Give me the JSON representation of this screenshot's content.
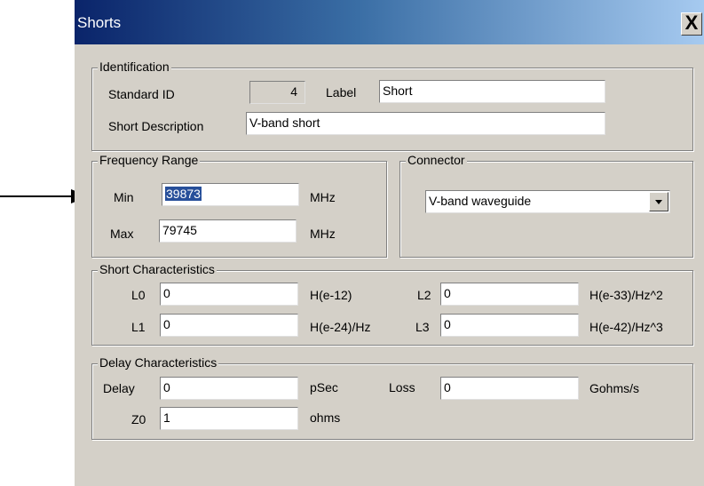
{
  "window": {
    "title": "Shorts",
    "close_glyph": "X"
  },
  "identification": {
    "legend": "Identification",
    "standard_id_label": "Standard ID",
    "standard_id_value": "4",
    "label_label": "Label",
    "label_value": "Short",
    "short_desc_label": "Short Description",
    "short_desc_value": "V-band short"
  },
  "frequency": {
    "legend": "Frequency Range",
    "min_label": "Min",
    "min_value": "39873",
    "min_unit": "MHz",
    "max_label": "Max",
    "max_value": "79745",
    "max_unit": "MHz"
  },
  "connector": {
    "legend": "Connector",
    "value": "V-band waveguide"
  },
  "short_char": {
    "legend": "Short Characteristics",
    "l0_label": "L0",
    "l0_value": "0",
    "l0_unit": "H(e-12)",
    "l1_label": "L1",
    "l1_value": "0",
    "l1_unit": "H(e-24)/Hz",
    "l2_label": "L2",
    "l2_value": "0",
    "l2_unit": "H(e-33)/Hz^2",
    "l3_label": "L3",
    "l3_value": "0",
    "l3_unit": "H(e-42)/Hz^3"
  },
  "delay_char": {
    "legend": "Delay Characteristics",
    "delay_label": "Delay",
    "delay_value": "0",
    "delay_unit": "pSec",
    "loss_label": "Loss",
    "loss_value": "0",
    "loss_unit": "Gohms/s",
    "z0_label": "Z0",
    "z0_value": "1",
    "z0_unit": "ohms"
  },
  "icons": {
    "callout": "arrow-right-icon",
    "dropdown": "chevron-down-icon",
    "close": "close-icon"
  }
}
